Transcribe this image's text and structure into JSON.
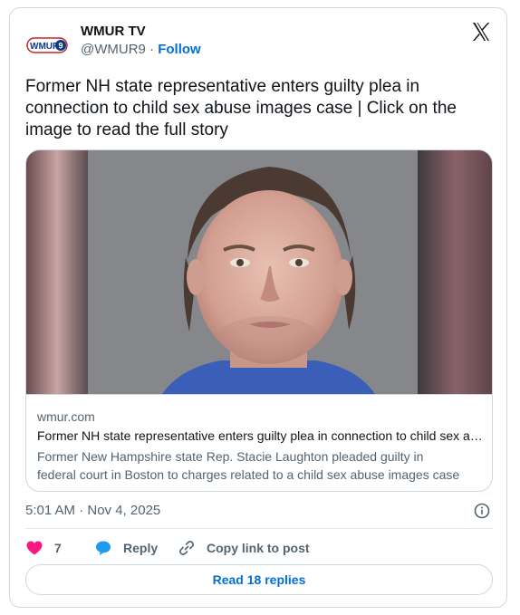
{
  "author": {
    "avatar_text": "WMUR",
    "avatar_badge": "9",
    "name": "WMUR TV",
    "handle": "@WMUR9",
    "separator": "·",
    "follow_label": "Follow"
  },
  "tweet": {
    "text": "Former NH state representative enters guilty plea in connection to child sex abuse images case  | Click on the image to read the full story"
  },
  "link_card": {
    "domain": "wmur.com",
    "title": "Former NH state representative enters guilty plea in connection to child sex abuse images case",
    "description_line1": "Former New Hampshire state Rep. Stacie Laughton pleaded guilty in",
    "description_line2": "federal court in Boston to charges related to a child sex abuse images case"
  },
  "timestamp": "5:01 AM · Nov 4, 2025",
  "actions": {
    "like_count": "7",
    "reply_label": "Reply",
    "copy_label": "Copy link to post"
  },
  "replies_button": "Read 18 replies",
  "colors": {
    "accent": "#006fd6",
    "like": "#f91880",
    "muted": "#536471",
    "border": "#cfd9de"
  },
  "icons": [
    "wmur-logo-icon",
    "x-logo-icon",
    "info-icon",
    "heart-icon",
    "reply-bubble-icon",
    "link-icon"
  ]
}
